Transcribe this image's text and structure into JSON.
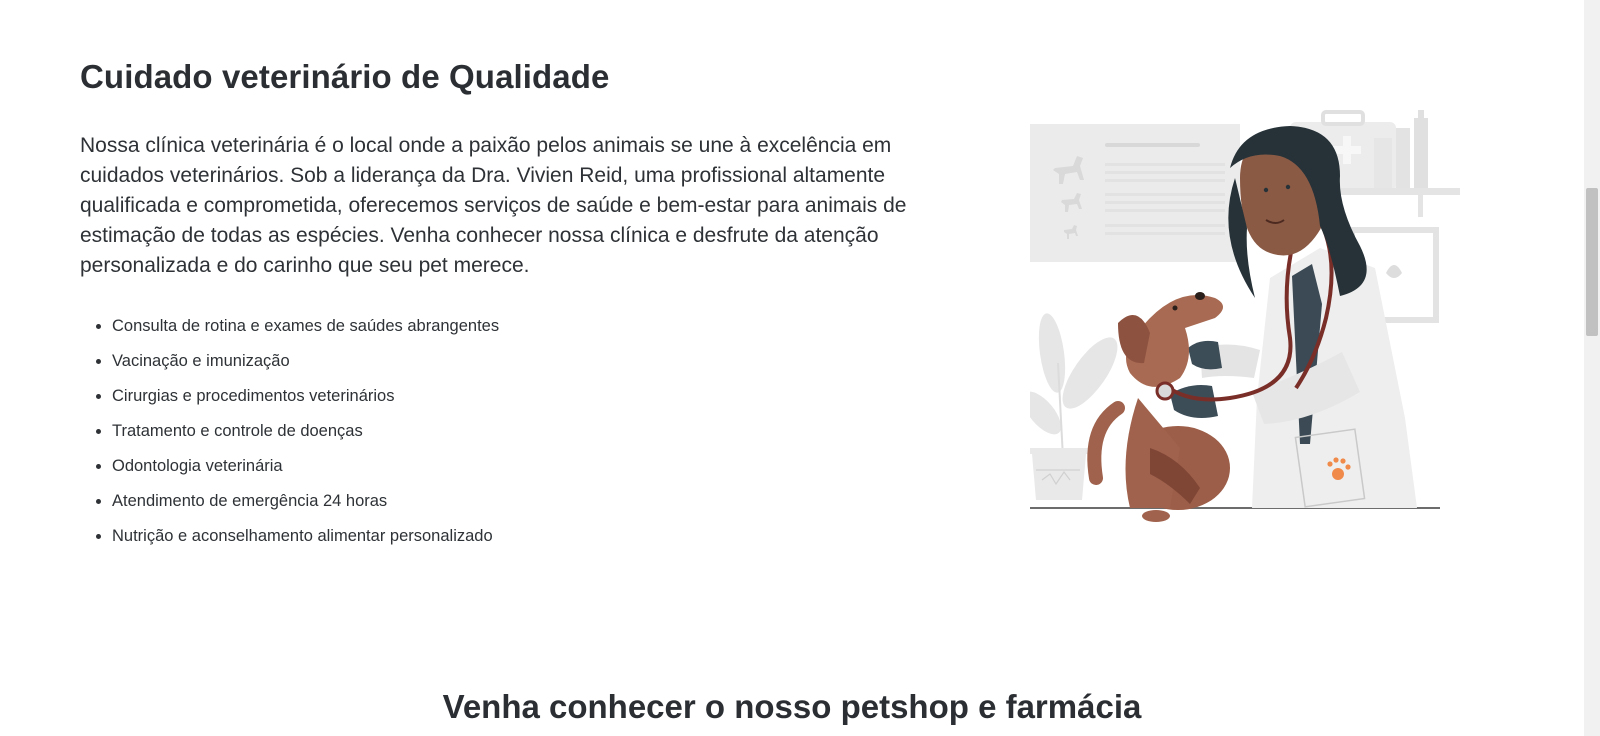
{
  "about": {
    "title": "Cuidado veterinário de Qualidade",
    "description": "Nossa clínica veterinária é o local onde a paixão pelos animais se une à excelência em cuidados veterinários. Sob a liderança da Dra. Vivien Reid, uma profissional altamente qualificada e comprometida, oferecemos serviços de saúde e bem-estar para animais de estimação de todas as espécies. Venha conhecer nossa clínica e desfrute da atenção personalizada e do carinho que seu pet merece.",
    "services": [
      "Consulta de rotina e exames de saúdes abrangentes",
      "Vacinação e imunização",
      "Cirurgias e procedimentos veterinários",
      "Tratamento e controle de doenças",
      "Odontologia veterinária",
      "Atendimento de emergência 24 horas",
      "Nutrição e aconselhamento alimentar personalizado"
    ],
    "illustration_icon": "veterinarian-with-dog-illustration"
  },
  "petshop": {
    "title": "Venha conhecer o nosso petshop e farmácia"
  },
  "colors": {
    "heading": "#2b2f33",
    "text": "#2e3236",
    "dog_brown": "#a0624c",
    "skin": "#8a5a45",
    "accent_paw": "#f08a4b"
  }
}
